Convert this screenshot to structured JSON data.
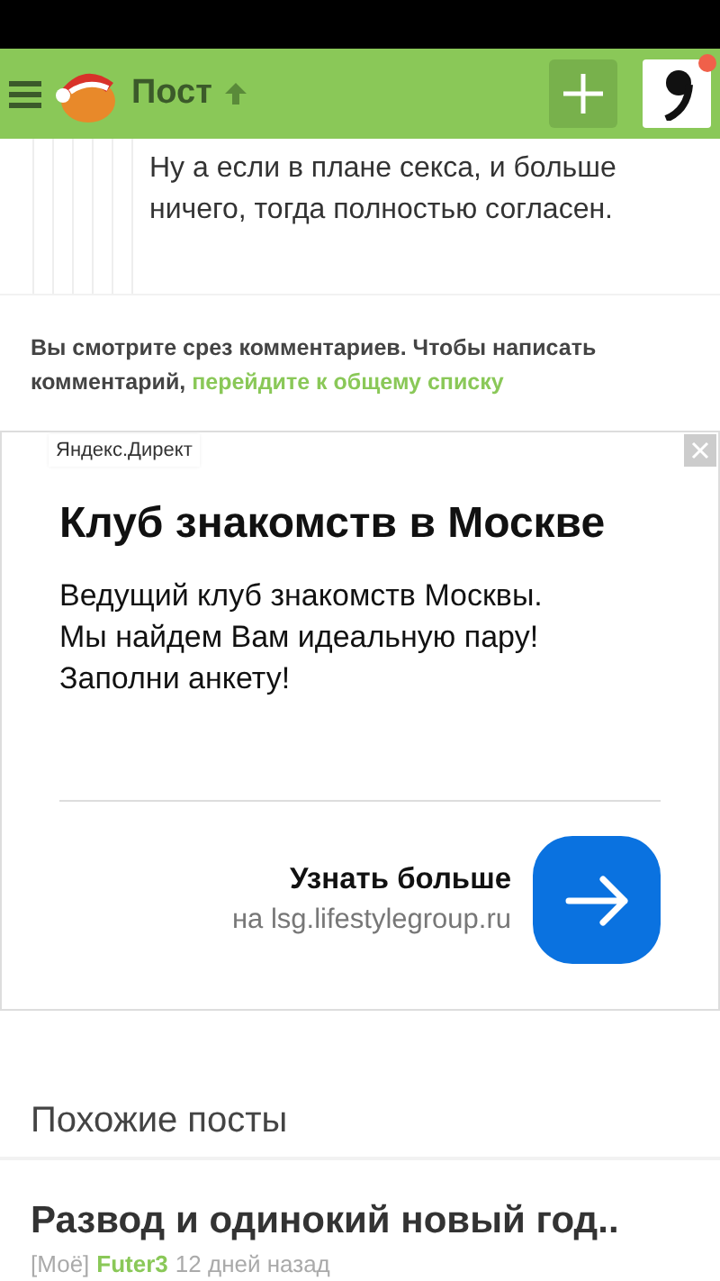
{
  "header": {
    "title": "Пост",
    "notification": true
  },
  "comment": {
    "lines": [
      "Ну а если в плане секса, и больше",
      "ничего, тогда полностью согласен."
    ]
  },
  "notice": {
    "text": "Вы смотрите срез комментариев. Чтобы написать комментарий,",
    "link": "перейдите к общему списку"
  },
  "ad": {
    "badge": "Яндекс.Директ",
    "title": "Клуб знакомств в Москве",
    "body": [
      "Ведущий клуб знакомств Москвы.",
      "Мы найдем Вам идеальную пару!",
      "Заполни анкету!"
    ],
    "cta": "Узнать больше",
    "domain": "на lsg.lifestylegroup.ru"
  },
  "similar": {
    "heading": "Похожие посты",
    "posts": [
      {
        "title": "Развод и одинокий новый год..",
        "tag": "[Моё]",
        "author": "Futer3",
        "time": "12 дней назад"
      }
    ]
  }
}
